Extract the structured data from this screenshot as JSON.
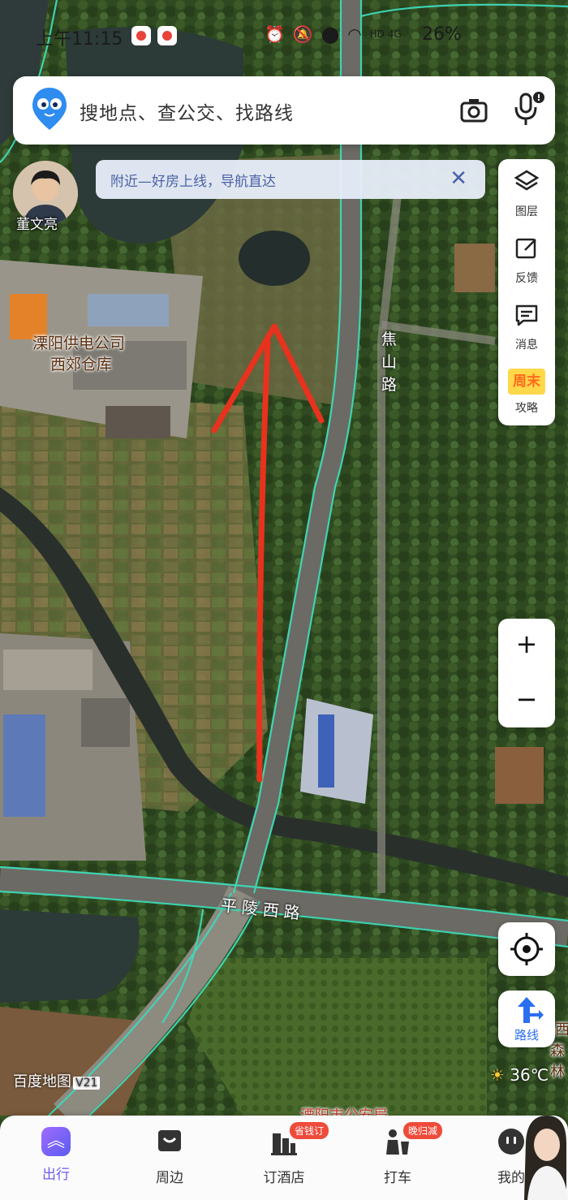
{
  "status_bar": {
    "time": "上午11:15",
    "network": "HD 4G",
    "battery": "26%"
  },
  "search": {
    "placeholder": "搜地点、查公交、找路线"
  },
  "notice": {
    "text": "附近—好房上线，导航直达"
  },
  "avatar": {
    "name": "董文亮"
  },
  "side_menu": {
    "items": [
      {
        "label": "图层",
        "icon": "layers-icon"
      },
      {
        "label": "反馈",
        "icon": "feedback-icon"
      },
      {
        "label": "消息",
        "icon": "message-icon"
      },
      {
        "label": "攻略",
        "icon": "weekend-guide-icon",
        "badge": "周末"
      }
    ]
  },
  "zoom": {
    "plus": "+",
    "minus": "−"
  },
  "route_button": {
    "label": "路线"
  },
  "weather": {
    "temp": "36℃"
  },
  "brand": {
    "name": "百度地图",
    "version": "V21"
  },
  "map_labels": {
    "poi_line1": "溧阳供电公司",
    "poi_line2": "西郊仓库",
    "road_vertical": "焦山路",
    "road_horizontal": "平陵西路",
    "edge_right_1": "西",
    "edge_right_2": "森林",
    "edge_bottom": "溧阳市公安局"
  },
  "tabs": [
    {
      "label": "出行",
      "active": true
    },
    {
      "label": "周边",
      "active": false
    },
    {
      "label": "订酒店",
      "active": false,
      "badge": "省钱订"
    },
    {
      "label": "打车",
      "active": false,
      "badge": "晚归减"
    },
    {
      "label": "我的",
      "active": false
    }
  ],
  "colors": {
    "road_line": "#3fd9b8",
    "arrow": "#e8321e",
    "accent": "#6b5cf5",
    "route_blue": "#2a6ef0"
  }
}
